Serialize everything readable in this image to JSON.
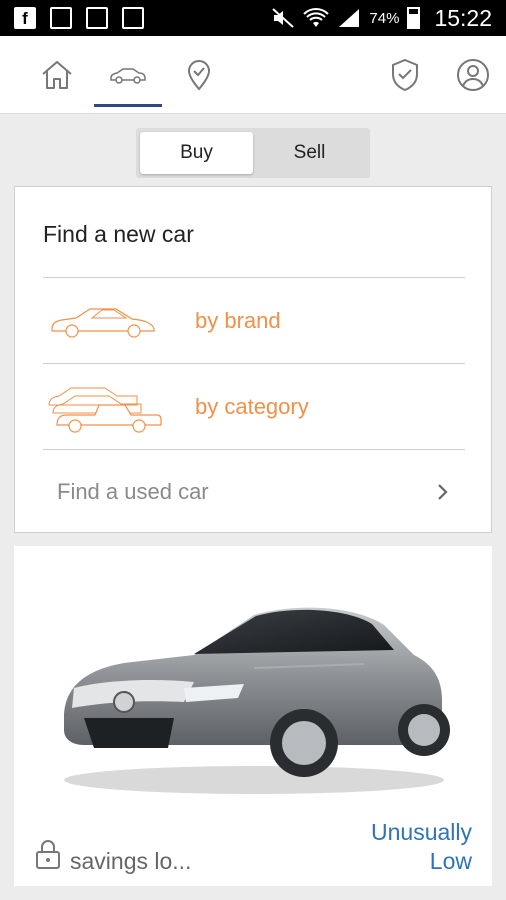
{
  "status_bar": {
    "battery_percent": "74%",
    "time": "15:22",
    "left_icons": [
      "facebook-icon",
      "notification-icon",
      "sim-icon",
      "image-icon"
    ],
    "right_icons": [
      "mute-icon",
      "wifi-icon",
      "signal-icon",
      "battery-icon"
    ]
  },
  "nav": {
    "items": [
      "home-icon",
      "car-icon",
      "checkmark-location-icon",
      "shield-check-icon",
      "profile-icon"
    ],
    "active": "car-icon"
  },
  "segment": {
    "buy_label": "Buy",
    "sell_label": "Sell",
    "selected": "Buy"
  },
  "find": {
    "title": "Find a new car",
    "by_brand_label": "by brand",
    "by_category_label": "by category",
    "used_label": "Find a used car"
  },
  "deal": {
    "savings_text": "savings lo...",
    "badge_line1": "Unusually",
    "badge_line2": "Low"
  },
  "colors": {
    "accent_orange": "#f0914a",
    "link_blue": "#2f73b8",
    "nav_active": "#2b4a7e",
    "background": "#ececec"
  }
}
